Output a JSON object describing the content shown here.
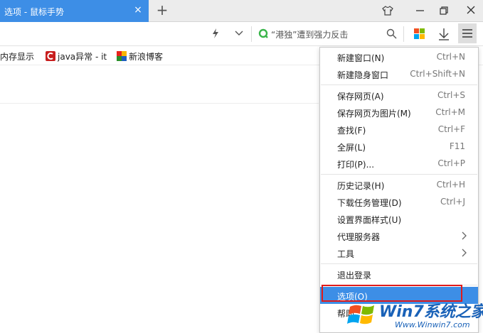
{
  "tab": {
    "title": "选项 - 鼠标手势",
    "close_glyph": "×",
    "new_tab_glyph": "+"
  },
  "search": {
    "text": "“港独”遭到强力反击"
  },
  "bookmarks": [
    {
      "label": "内存显示"
    },
    {
      "label": "java异常 - it"
    },
    {
      "label": "新浪博客"
    }
  ],
  "menu": {
    "items": [
      {
        "label": "新建窗口(N)",
        "shortcut": "Ctrl+N"
      },
      {
        "label": "新建隐身窗口",
        "shortcut": "Ctrl+Shift+N"
      },
      {
        "label": "保存网页(A)",
        "shortcut": "Ctrl+S"
      },
      {
        "label": "保存网页为图片(M)",
        "shortcut": "Ctrl+M"
      },
      {
        "label": "查找(F)",
        "shortcut": "Ctrl+F"
      },
      {
        "label": "全屏(L)",
        "shortcut": "F11"
      },
      {
        "label": "打印(P)...",
        "shortcut": "Ctrl+P"
      },
      {
        "label": "历史记录(H)",
        "shortcut": "Ctrl+H"
      },
      {
        "label": "下载任务管理(D)",
        "shortcut": "Ctrl+J"
      },
      {
        "label": "设置界面样式(U)",
        "shortcut": ""
      },
      {
        "label": "代理服务器",
        "shortcut": ""
      },
      {
        "label": "工具",
        "shortcut": ""
      },
      {
        "label": "退出登录",
        "shortcut": ""
      },
      {
        "label": "选项(O)",
        "shortcut": ""
      },
      {
        "label": "帮助",
        "shortcut": ""
      }
    ]
  },
  "watermark": {
    "brand": "Win7系统之家",
    "url": "Www.Winwin7.com"
  },
  "colors": {
    "accent": "#3d8ee6",
    "highlight_box": "#e01a1a"
  }
}
